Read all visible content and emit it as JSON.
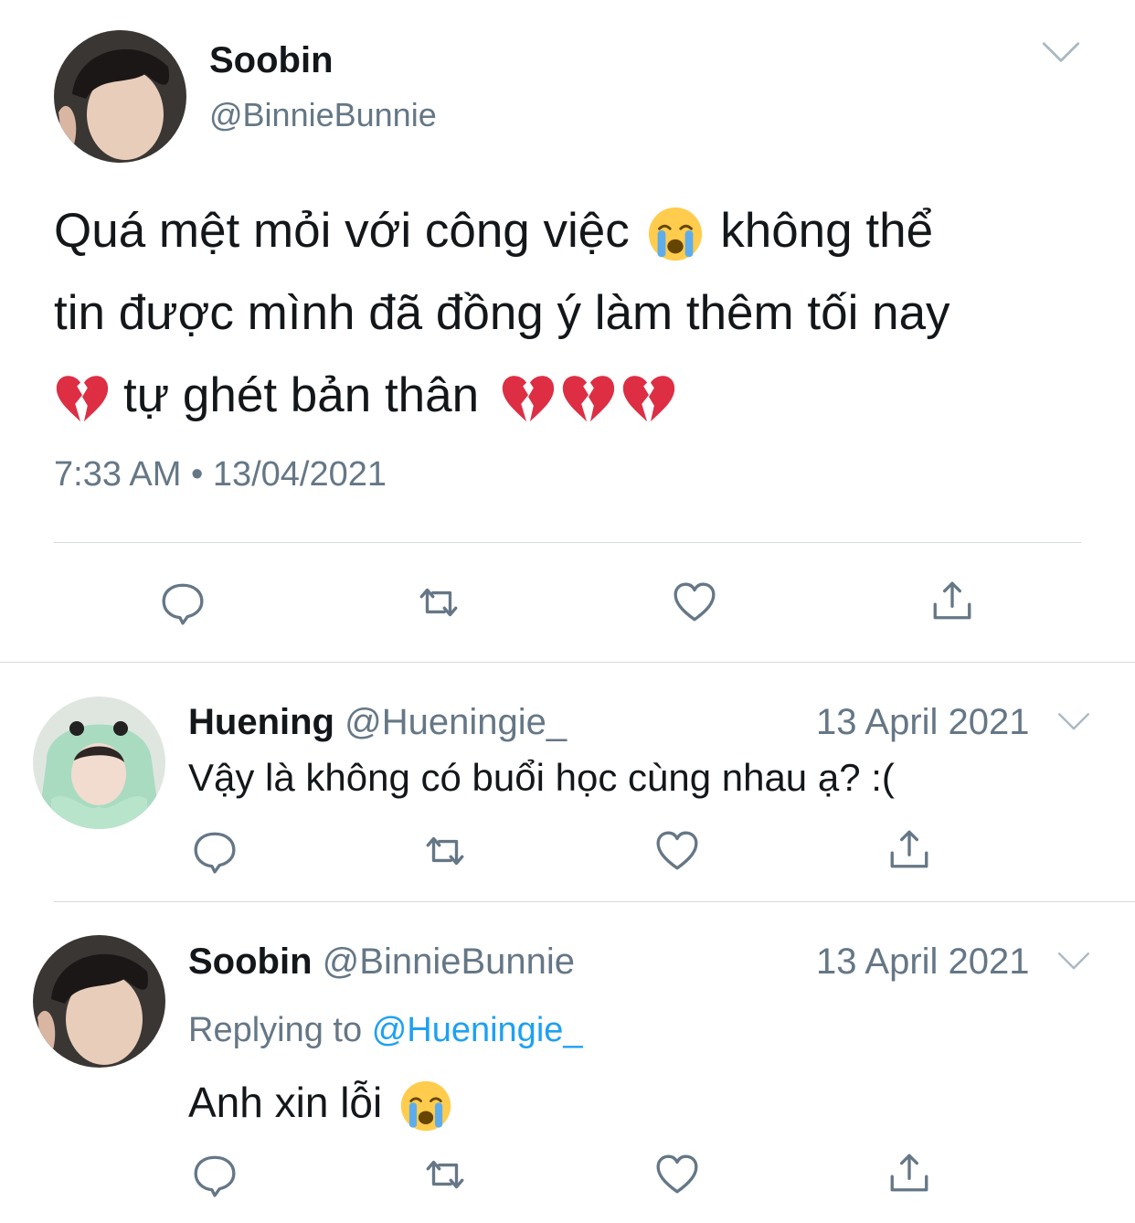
{
  "main_tweet": {
    "author_name": "Soobin",
    "author_handle": "@BinnieBunnie",
    "text_line1_a": "Quá mệt mỏi với công việc",
    "text_line1_b": "không thể",
    "text_line2": "tin được mình đã đồng ý làm thêm tối nay",
    "text_line3": "tự ghét bản thân",
    "timestamp": "7:33 AM • 13/04/2021",
    "emojis": [
      "loudly-crying-face",
      "broken-heart"
    ]
  },
  "replies": [
    {
      "author_name": "Huening",
      "author_handle": "@Hueningie_",
      "date": "13 April 2021",
      "text": "Vậy là không có buổi học cùng nhau ạ? :("
    },
    {
      "author_name": "Soobin",
      "author_handle": "@BinnieBunnie",
      "date": "13 April 2021",
      "replying_prefix": "Replying to",
      "replying_to": "@Hueningie_",
      "text": "Anh xin lỗi"
    }
  ],
  "actions": [
    "reply-icon",
    "retweet-icon",
    "like-icon",
    "share-icon"
  ],
  "colors": {
    "text": "#14171a",
    "secondary": "#657786",
    "link": "#1da1f2",
    "divider": "#d6dbe0"
  }
}
